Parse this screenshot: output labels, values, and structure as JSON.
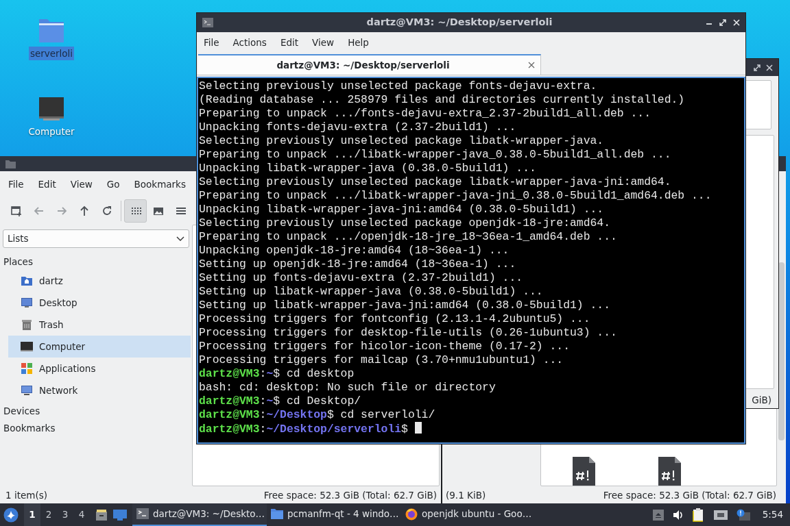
{
  "desktop_icons": [
    {
      "label": "serverloli",
      "kind": "folder",
      "selected": true
    },
    {
      "label": "Computer",
      "kind": "computer",
      "selected": false
    }
  ],
  "back_window": {
    "status": "GiB)"
  },
  "file_manager": {
    "menu": [
      "File",
      "Edit",
      "View",
      "Go",
      "Bookmarks"
    ],
    "toolbar": [
      {
        "kind": "new-tab",
        "disabled": false,
        "pressed": false
      },
      {
        "kind": "back",
        "disabled": true,
        "pressed": false
      },
      {
        "kind": "forward",
        "disabled": true,
        "pressed": false
      },
      {
        "kind": "up",
        "disabled": false,
        "pressed": false
      },
      {
        "kind": "reload",
        "disabled": false,
        "pressed": false
      },
      {
        "kind": "icon-view",
        "disabled": false,
        "pressed": true
      },
      {
        "kind": "thumbnail-view",
        "disabled": false,
        "pressed": false
      },
      {
        "kind": "list-view",
        "disabled": false,
        "pressed": false
      }
    ],
    "side_pane_mode": "Lists",
    "places_header": "Places",
    "places": [
      {
        "label": "dartz",
        "kind": "home",
        "selected": false
      },
      {
        "label": "Desktop",
        "kind": "desktop",
        "selected": false
      },
      {
        "label": "Trash",
        "kind": "trash",
        "selected": false
      },
      {
        "label": "Computer",
        "kind": "computer",
        "selected": true
      },
      {
        "label": "Applications",
        "kind": "applications",
        "selected": false
      },
      {
        "label": "Network",
        "kind": "network",
        "selected": false
      }
    ],
    "sections": [
      "Devices",
      "Bookmarks"
    ],
    "status_items": "1 item(s)",
    "status_middle": "Free space: 52.3 GiB (Total: 62.7 GiB)",
    "status_size": "(9.1 KiB)",
    "status_right": "Free space: 52.3 GiB (Total: 62.7 GiB)",
    "files": [
      {
        "kind": "script"
      },
      {
        "kind": "script"
      }
    ]
  },
  "terminal": {
    "title": "dartz@VM3: ~/Desktop/serverloli",
    "menu": [
      "File",
      "Actions",
      "Edit",
      "View",
      "Help"
    ],
    "tabs": [
      {
        "label": "dartz@VM3: ~/Desktop/serverloli",
        "selected": true
      }
    ],
    "lines": [
      {
        "kind": "output",
        "text": "Selecting previously unselected package fonts-dejavu-extra."
      },
      {
        "kind": "output",
        "text": "(Reading database ... 258979 files and directories currently installed.)"
      },
      {
        "kind": "output",
        "text": "Preparing to unpack .../fonts-dejavu-extra_2.37-2build1_all.deb ..."
      },
      {
        "kind": "output",
        "text": "Unpacking fonts-dejavu-extra (2.37-2build1) ..."
      },
      {
        "kind": "output",
        "text": "Selecting previously unselected package libatk-wrapper-java."
      },
      {
        "kind": "output",
        "text": "Preparing to unpack .../libatk-wrapper-java_0.38.0-5build1_all.deb ..."
      },
      {
        "kind": "output",
        "text": "Unpacking libatk-wrapper-java (0.38.0-5build1) ..."
      },
      {
        "kind": "output",
        "text": "Selecting previously unselected package libatk-wrapper-java-jni:amd64."
      },
      {
        "kind": "output",
        "text": "Preparing to unpack .../libatk-wrapper-java-jni_0.38.0-5build1_amd64.deb ..."
      },
      {
        "kind": "output",
        "text": "Unpacking libatk-wrapper-java-jni:amd64 (0.38.0-5build1) ..."
      },
      {
        "kind": "output",
        "text": "Selecting previously unselected package openjdk-18-jre:amd64."
      },
      {
        "kind": "output",
        "text": "Preparing to unpack .../openjdk-18-jre_18~36ea-1_amd64.deb ..."
      },
      {
        "kind": "output",
        "text": "Unpacking openjdk-18-jre:amd64 (18~36ea-1) ..."
      },
      {
        "kind": "output",
        "text": "Setting up openjdk-18-jre:amd64 (18~36ea-1) ..."
      },
      {
        "kind": "output",
        "text": "Setting up fonts-dejavu-extra (2.37-2build1) ..."
      },
      {
        "kind": "output",
        "text": "Setting up libatk-wrapper-java (0.38.0-5build1) ..."
      },
      {
        "kind": "output",
        "text": "Setting up libatk-wrapper-java-jni:amd64 (0.38.0-5build1) ..."
      },
      {
        "kind": "output",
        "text": "Processing triggers for fontconfig (2.13.1-4.2ubuntu5) ..."
      },
      {
        "kind": "output",
        "text": "Processing triggers for desktop-file-utils (0.26-1ubuntu3) ..."
      },
      {
        "kind": "output",
        "text": "Processing triggers for hicolor-icon-theme (0.17-2) ..."
      },
      {
        "kind": "output",
        "text": "Processing triggers for mailcap (3.70+nmu1ubuntu1) ..."
      },
      {
        "kind": "prompt",
        "user": "dartz@VM3",
        "sep": ":",
        "path": "~",
        "command": "$ cd desktop",
        "cursor": false
      },
      {
        "kind": "output",
        "text": "bash: cd: desktop: No such file or directory"
      },
      {
        "kind": "prompt",
        "user": "dartz@VM3",
        "sep": ":",
        "path": "~",
        "command": "$ cd Desktop/",
        "cursor": false
      },
      {
        "kind": "prompt",
        "user": "dartz@VM3",
        "sep": ":",
        "path": "~/Desktop",
        "command": "$ cd serverloli/",
        "cursor": false
      },
      {
        "kind": "prompt",
        "user": "dartz@VM3",
        "sep": ":",
        "path": "~/Desktop/serverloli",
        "command": "$ ",
        "cursor": true
      }
    ]
  },
  "taskbar": {
    "workspaces": [
      {
        "label": "1",
        "selected": true
      },
      {
        "label": "2",
        "selected": false
      },
      {
        "label": "3",
        "selected": false
      },
      {
        "label": "4",
        "selected": false
      }
    ],
    "tasks": [
      {
        "label": "dartz@VM3: ~/Deskto…",
        "kind": "terminal",
        "selected": true
      },
      {
        "label": "pcmanfm-qt - 4 windo…",
        "kind": "folder",
        "selected": false
      },
      {
        "label": "openjdk ubuntu - Goo…",
        "kind": "browser",
        "selected": false
      }
    ],
    "clock": "5:54"
  }
}
